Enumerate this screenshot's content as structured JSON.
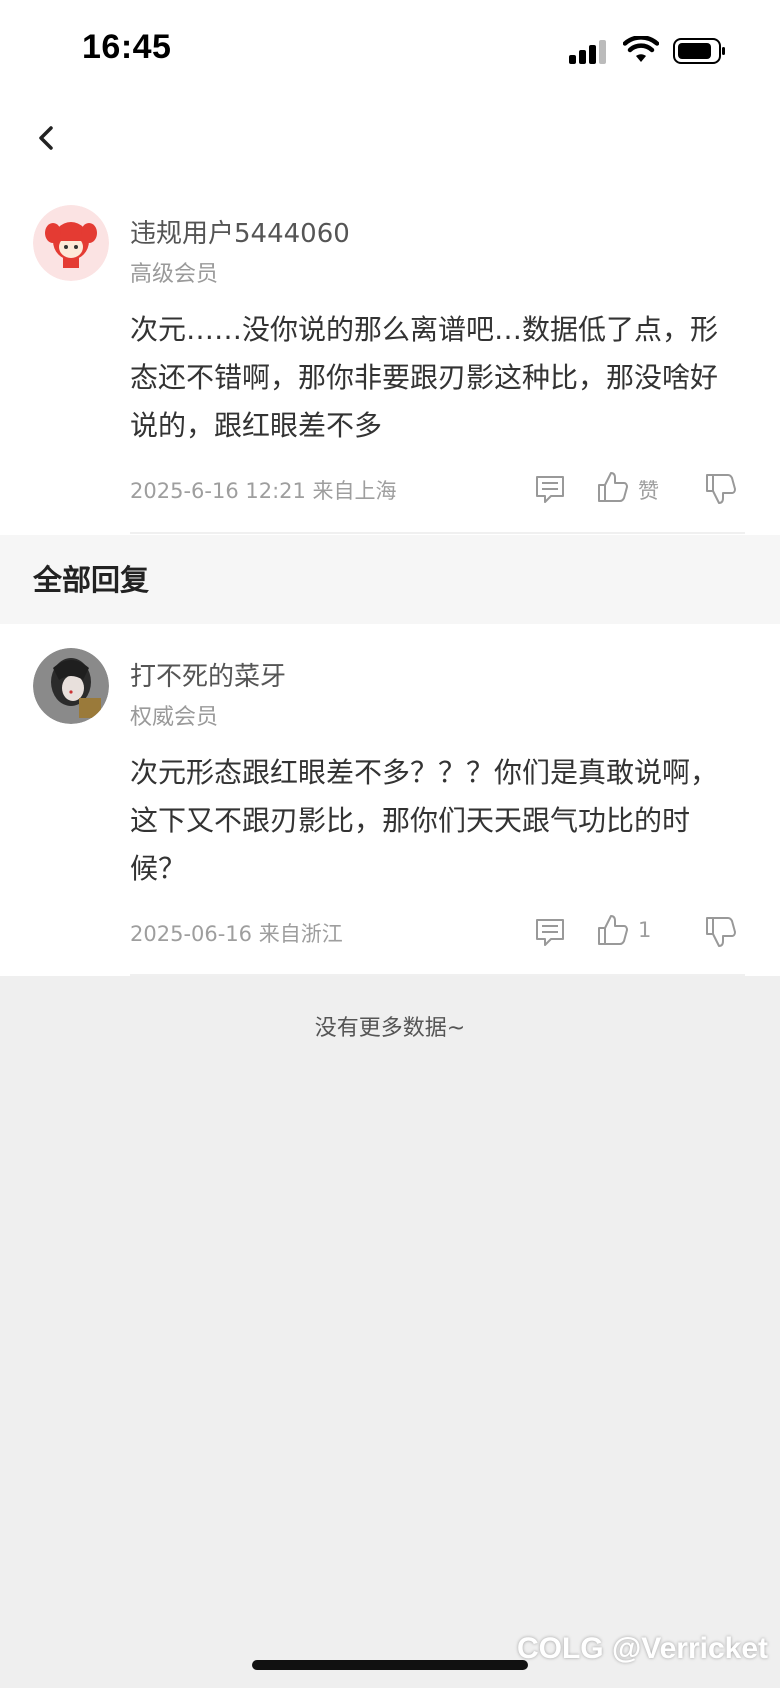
{
  "status_bar": {
    "time": "16:45"
  },
  "main_comment": {
    "username": "违规用户5444060",
    "level": "高级会员",
    "text": "次元……没你说的那么离谱吧…数据低了点，形态还不错啊，那你非要跟刃影这种比，那没啥好说的，跟红眼差不多",
    "meta": "2025-6-16 12:21  来自上海",
    "like_label": "赞"
  },
  "section": {
    "title": "全部回复"
  },
  "reply": {
    "username": "打不死的菜牙",
    "level": "权威会员",
    "text": "次元形态跟红眼差不多？？？你们是真敢说啊，这下又不跟刃影比，那你们天天跟气功比的时候？",
    "meta": "2025-06-16  来自浙江",
    "like_count": "1"
  },
  "footer": {
    "no_more": "没有更多数据~"
  },
  "watermark": "COLG @Verricket",
  "colors": {
    "background": "#efefef",
    "card": "#ffffff",
    "text": "#333333",
    "muted": "#9e9e9e"
  },
  "icons": [
    "back-chevron-icon",
    "comment-icon",
    "thumbs-up-icon",
    "thumbs-down-icon"
  ]
}
